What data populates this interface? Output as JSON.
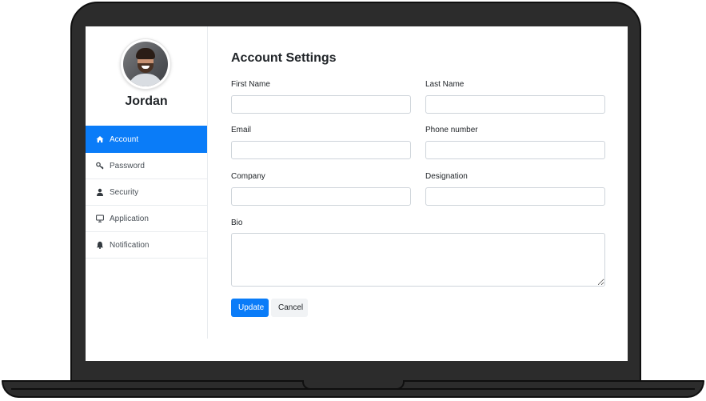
{
  "profile": {
    "name": "Jordan"
  },
  "sidebar": {
    "items": [
      {
        "label": "Account",
        "icon": "home-icon",
        "active": true
      },
      {
        "label": "Password",
        "icon": "key-icon",
        "active": false
      },
      {
        "label": "Security",
        "icon": "user-icon",
        "active": false
      },
      {
        "label": "Application",
        "icon": "monitor-icon",
        "active": false
      },
      {
        "label": "Notification",
        "icon": "bell-icon",
        "active": false
      }
    ]
  },
  "main": {
    "title": "Account Settings",
    "fields": {
      "first_name": {
        "label": "First Name",
        "value": ""
      },
      "last_name": {
        "label": "Last Name",
        "value": ""
      },
      "email": {
        "label": "Email",
        "value": ""
      },
      "phone": {
        "label": "Phone number",
        "value": ""
      },
      "company": {
        "label": "Company",
        "value": ""
      },
      "designation": {
        "label": "Designation",
        "value": ""
      },
      "bio": {
        "label": "Bio",
        "value": ""
      }
    },
    "update_label": "Update",
    "cancel_label": "Cancel"
  },
  "colors": {
    "accent": "#0a7cf8",
    "bezel": "#2c2c2c"
  }
}
